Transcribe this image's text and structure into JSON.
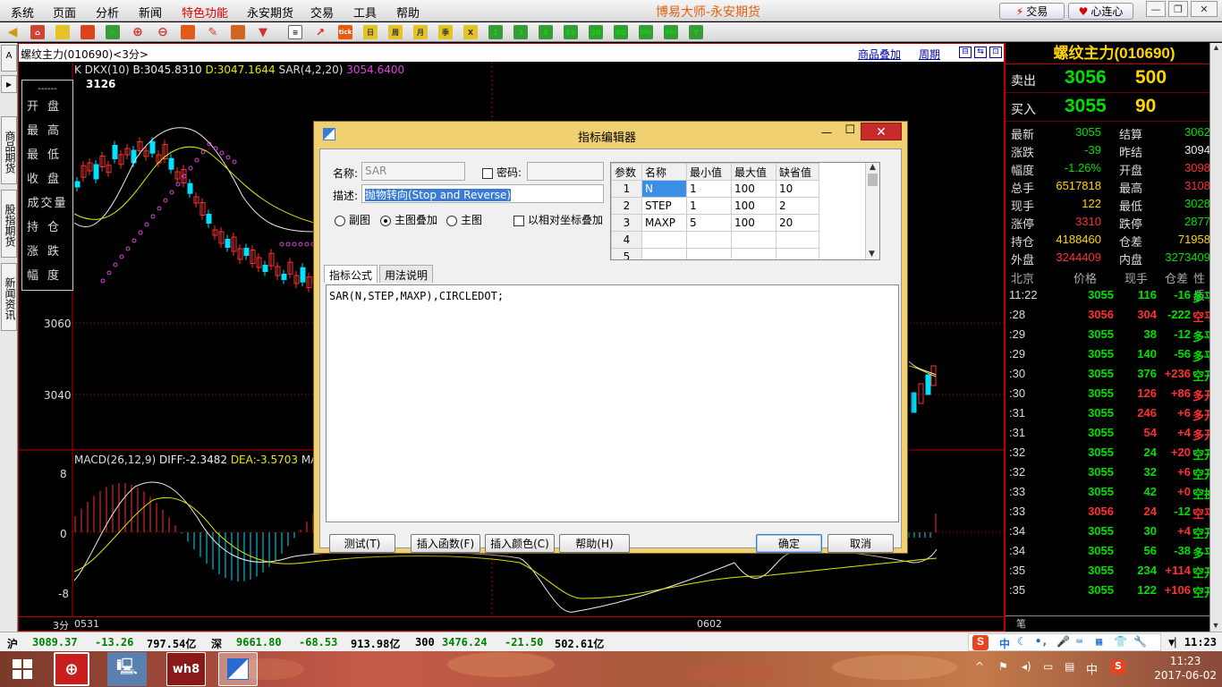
{
  "menu": {
    "items": [
      "系统",
      "页面",
      "分析",
      "新闻",
      "特色功能",
      "永安期货",
      "交易",
      "工具",
      "帮助"
    ],
    "active_index": 4,
    "app_title": "博易大师-永安期货",
    "trade_button": "交易",
    "support_button": "心连心"
  },
  "toolbar": {
    "buttons": [
      "1",
      "3",
      "5",
      "15",
      "30",
      "60",
      "2hr",
      "4hr",
      "Y"
    ]
  },
  "side_tabs": {
    "top": "A",
    "tabs": [
      "商品期货",
      "股指期货",
      "新闻资讯"
    ]
  },
  "chart": {
    "title": "螺纹主力(010690)<3分>",
    "overlay_link": "商品叠加",
    "period_link": "周期",
    "indicator_label": "K DKX(10)",
    "dkx_b": "B:3045.8310",
    "dkx_d": "D:3047.1644",
    "sar_label": "SAR(4,2,20)",
    "sar_value": "3054.6400",
    "high_label": "3126",
    "y_labels": [
      "3060",
      "3040"
    ],
    "macd_label": "MACD(26,12,9)",
    "macd_diff": "DIFF:-2.3482",
    "macd_dea": "DEA:-3.5703",
    "macd_extra": "MACD",
    "macd_y": [
      "8",
      "0",
      "-8"
    ],
    "period_label": "3分",
    "x_labels": [
      "0531",
      "0602"
    ],
    "ohlc_box": [
      [
        "开",
        "盘"
      ],
      [
        "最",
        "高"
      ],
      [
        "最",
        "低"
      ],
      [
        "收",
        "盘"
      ],
      [
        "成交",
        "量"
      ],
      [
        "持",
        "仓"
      ],
      [
        "涨",
        "跌"
      ],
      [
        "幅",
        "度"
      ]
    ],
    "ohlc_top": "------"
  },
  "dialog": {
    "title": "指标编辑器",
    "name_label": "名称:",
    "name_value": "SAR",
    "password_label": "密码:",
    "desc_label": "描述:",
    "desc_value": "抛物转向(Stop and Reverse)",
    "radio_sub": "副图",
    "radio_overlay": "主图叠加",
    "radio_main": "主图",
    "relative_check": "以相对坐标叠加",
    "param_headers": [
      "参数",
      "名称",
      "最小值",
      "最大值",
      "缺省值"
    ],
    "params": [
      {
        "n": "1",
        "name": "N",
        "min": "1",
        "max": "100",
        "def": "10"
      },
      {
        "n": "2",
        "name": "STEP",
        "min": "1",
        "max": "100",
        "def": "2"
      },
      {
        "n": "3",
        "name": "MAXP",
        "min": "5",
        "max": "100",
        "def": "20"
      },
      {
        "n": "4",
        "name": "",
        "min": "",
        "max": "",
        "def": ""
      },
      {
        "n": "5",
        "name": "",
        "min": "",
        "max": "",
        "def": ""
      }
    ],
    "tab_formula": "指标公式",
    "tab_usage": "用法说明",
    "formula": "SAR(N,STEP,MAXP),CIRCLEDOT;",
    "btn_test": "测试(T)",
    "btn_insert_func": "插入函数(F)",
    "btn_insert_color": "插入颜色(C)",
    "btn_help": "帮助(H)",
    "btn_ok": "确定",
    "btn_cancel": "取消"
  },
  "quote": {
    "title": "螺纹主力(010690)",
    "ask_label": "卖出",
    "ask_price": "3056",
    "ask_vol": "500",
    "bid_label": "买入",
    "bid_price": "3055",
    "bid_vol": "90",
    "stats": [
      [
        "最新",
        "3055",
        "g",
        "结算",
        "3062",
        "g"
      ],
      [
        "涨跌",
        "-39",
        "g",
        "昨结",
        "3094",
        "w"
      ],
      [
        "幅度",
        "-1.26%",
        "g",
        "开盘",
        "3098",
        "rr"
      ],
      [
        "总手",
        "6517818",
        "y",
        "最高",
        "3108",
        "rr"
      ],
      [
        "现手",
        "122",
        "y",
        "最低",
        "3028",
        "g"
      ],
      [
        "涨停",
        "3310",
        "rr",
        "跌停",
        "2877",
        "g"
      ],
      [
        "持仓",
        "4188460",
        "y",
        "仓差",
        "71958",
        "y"
      ],
      [
        "外盘",
        "3244409",
        "rr",
        "内盘",
        "3273409",
        "g"
      ]
    ],
    "tick_headers": [
      "北京",
      "价格",
      "现手",
      "仓差",
      "性质"
    ],
    "ticks": [
      [
        "11:22",
        "3055",
        "116",
        "-16",
        "多平",
        "g"
      ],
      [
        ":28",
        "3056",
        "304",
        "-222",
        "空平",
        "rr"
      ],
      [
        ":29",
        "3055",
        "38",
        "-12",
        "多平",
        "g"
      ],
      [
        ":29",
        "3055",
        "140",
        "-56",
        "多平",
        "g"
      ],
      [
        ":30",
        "3055",
        "376",
        "+236",
        "空开",
        "g"
      ],
      [
        ":30",
        "3055",
        "126",
        "+86",
        "多开",
        "rr"
      ],
      [
        ":31",
        "3055",
        "246",
        "+6",
        "多开",
        "rr"
      ],
      [
        ":31",
        "3055",
        "54",
        "+4",
        "多开",
        "rr"
      ],
      [
        ":32",
        "3055",
        "24",
        "+20",
        "空开",
        "g"
      ],
      [
        ":32",
        "3055",
        "32",
        "+6",
        "空开",
        "g"
      ],
      [
        ":33",
        "3055",
        "42",
        "+0",
        "空换",
        "g"
      ],
      [
        ":33",
        "3056",
        "24",
        "-12",
        "空平",
        "rr"
      ],
      [
        ":34",
        "3055",
        "30",
        "+4",
        "空开",
        "g"
      ],
      [
        ":34",
        "3055",
        "56",
        "-38",
        "多平",
        "g"
      ],
      [
        ":35",
        "3055",
        "234",
        "+114",
        "空开",
        "g"
      ],
      [
        ":35",
        "3055",
        "122",
        "+106",
        "空开",
        "g"
      ]
    ],
    "footer": "笔"
  },
  "statusbar": {
    "sh_label": "沪",
    "sh_index": "3089.37",
    "sh_change": "-13.26",
    "sh_amount": "797.54亿",
    "sz_label": "深",
    "sz_index": "9661.80",
    "sz_change": "-68.53",
    "sz_amount": "913.98亿",
    "hs_label": "300",
    "hs_index": "3476.24",
    "hs_change": "-21.50",
    "hs_amount": "502.61亿",
    "ime_label": "中",
    "time": "11:23"
  },
  "taskbar": {
    "tray_lang": "中",
    "clock_time": "11:23",
    "clock_date": "2017-06-02"
  }
}
